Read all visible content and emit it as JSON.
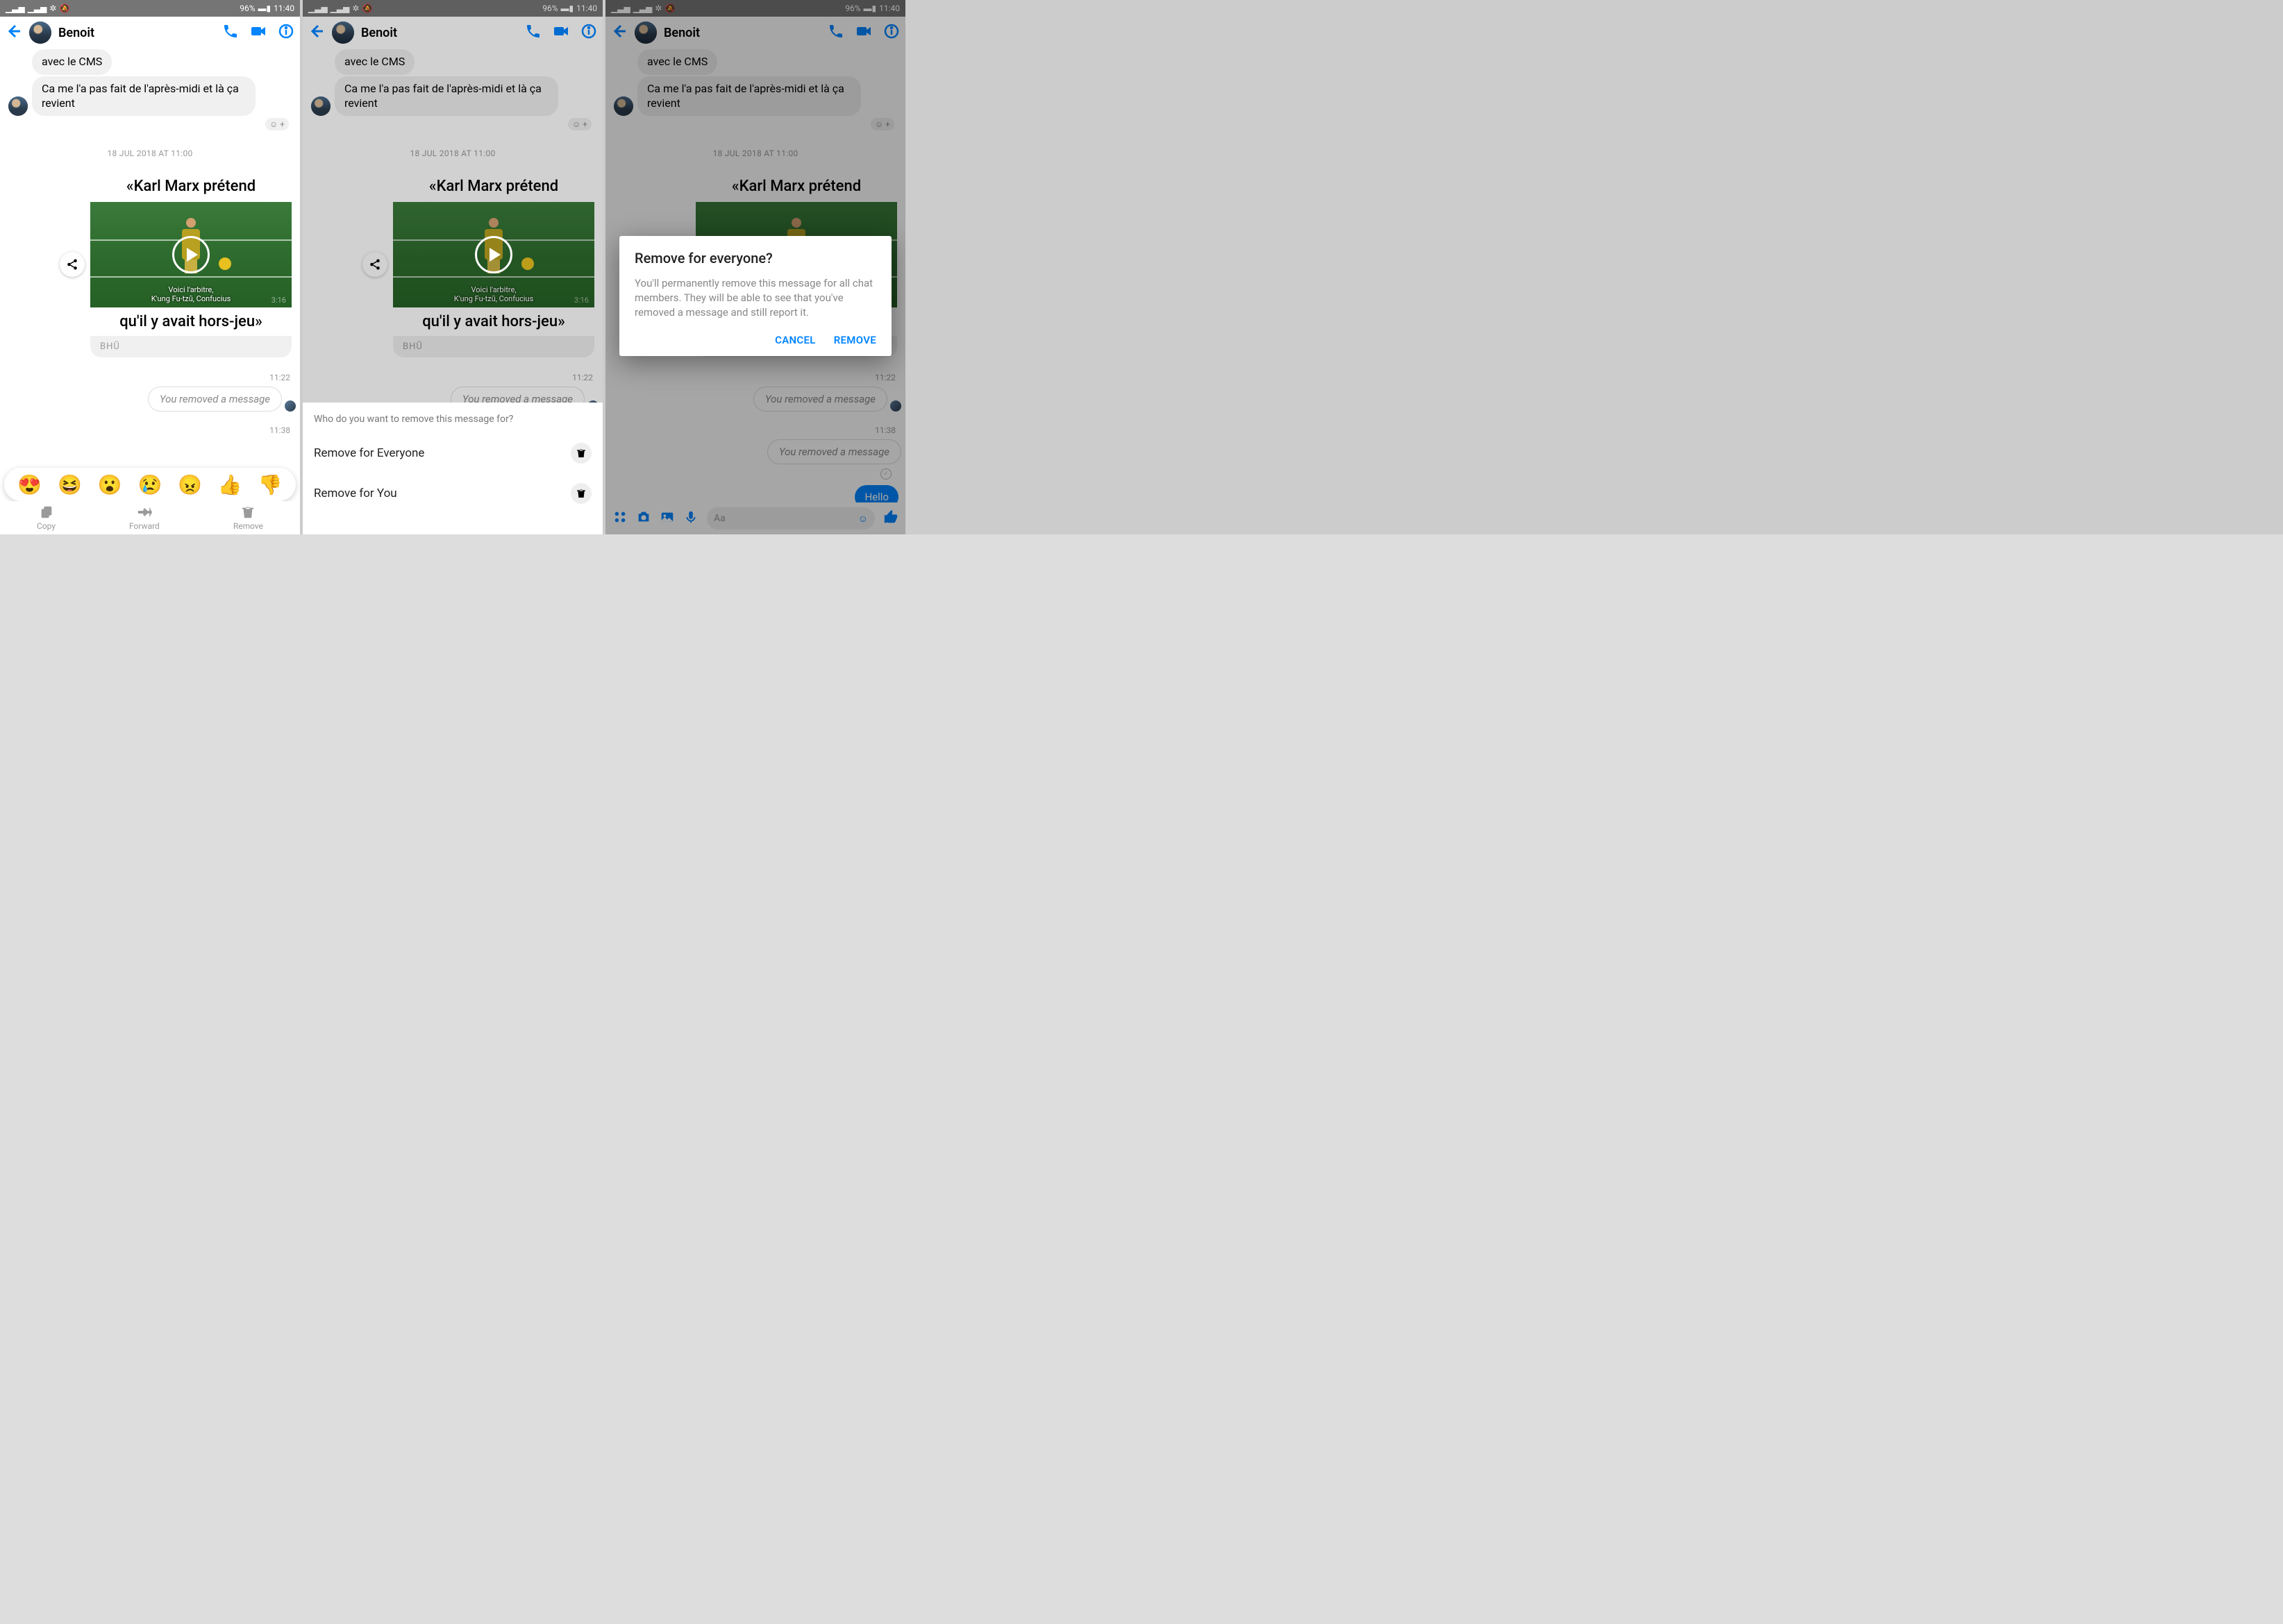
{
  "status": {
    "battery": "96%",
    "time": "11:40"
  },
  "contact": "Benoit",
  "messages": {
    "m1": "avec le CMS",
    "m2": "Ca me l'a pas fait de l'après-midi et là ça revient"
  },
  "separator": "18 JUL 2018 AT 11:00",
  "card": {
    "line1": "«Karl Marx prétend",
    "sub1": "Voici l'arbitre,",
    "sub2": "K'ung Fu-tzū, Confucius",
    "duration": "3:16",
    "line2": "qu'il y avait hors-jeu»",
    "source": "BHŪ"
  },
  "t1": "11:22",
  "removed": "You removed a message",
  "t2": "11:38",
  "hello": "Hello",
  "emojis": [
    "😍",
    "😆",
    "😮",
    "😢",
    "😠",
    "👍",
    "👎"
  ],
  "actions": {
    "copy": "Copy",
    "forward": "Forward",
    "remove": "Remove"
  },
  "sheet": {
    "q": "Who do you want to remove this message for?",
    "opt1": "Remove for Everyone",
    "opt2": "Remove for You"
  },
  "dialog": {
    "title": "Remove for everyone?",
    "body": "You'll permanently remove this message for all chat members. They will be able to see that you've removed a message and still report it.",
    "cancel": "CANCEL",
    "confirm": "REMOVE"
  },
  "composer": {
    "placeholder": "Aa"
  }
}
